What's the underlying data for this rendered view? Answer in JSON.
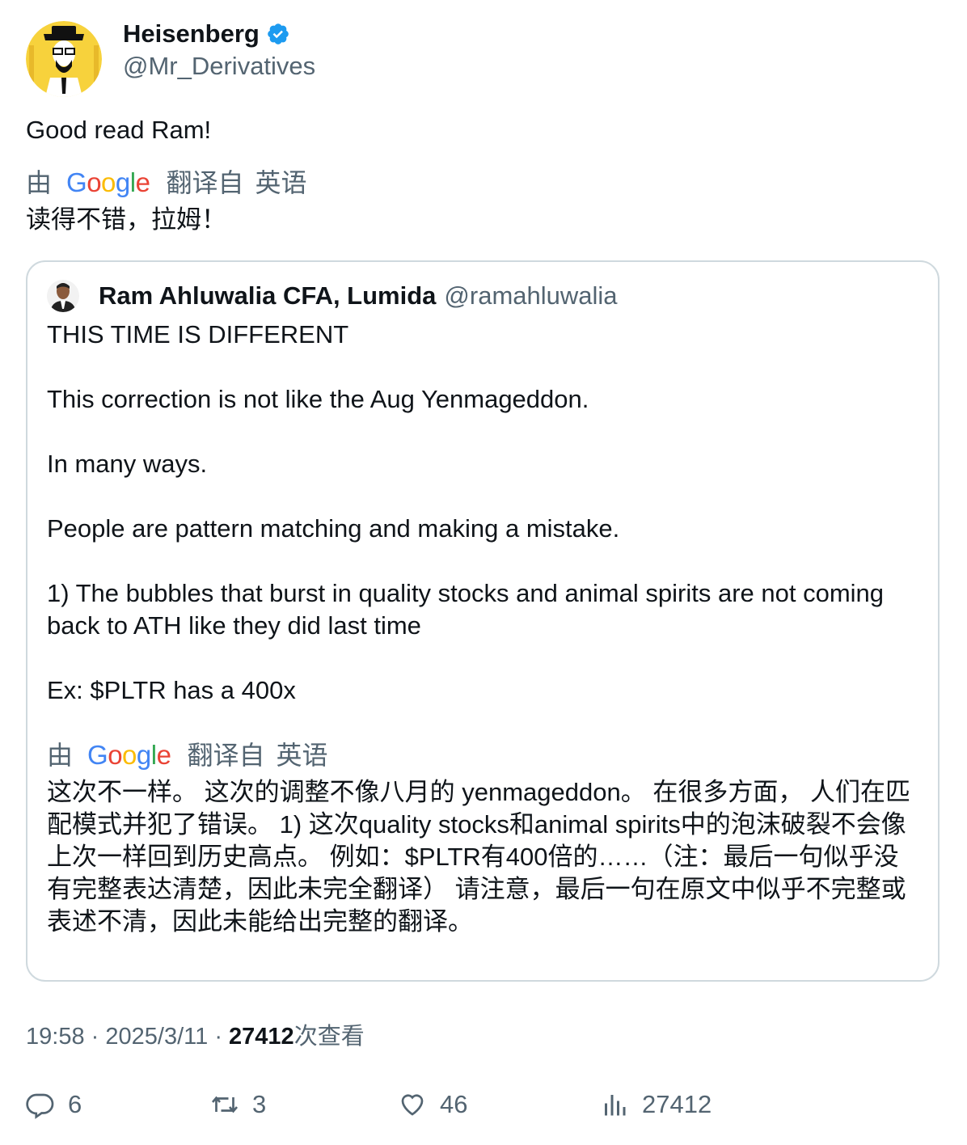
{
  "author": {
    "display_name": "Heisenberg",
    "handle": "@Mr_Derivatives",
    "verified": true
  },
  "tweet": {
    "text": "Good read Ram!",
    "translation_label": {
      "by": "由",
      "provider": "Google",
      "translated_from": "翻译自",
      "language": "英语"
    },
    "translation": "读得不错，拉姆！"
  },
  "quoted_tweet": {
    "display_name": "Ram Ahluwalia CFA, Lumida",
    "handle": "@ramahluwalia",
    "paragraphs": [
      "THIS TIME IS DIFFERENT",
      "This correction is not like the Aug Yenmageddon.",
      "In many ways.",
      "People are pattern matching and making a mistake.",
      "1) The bubbles that burst in quality stocks and animal spirits are not coming back to ATH like they did last time",
      "Ex: $PLTR has a 400x"
    ],
    "translation_label": {
      "by": "由",
      "provider": "Google",
      "translated_from": "翻译自",
      "language": "英语"
    },
    "translation": "这次不一样。 这次的调整不像八月的 yenmageddon。 在很多方面， 人们在匹配模式并犯了错误。 1) 这次quality stocks和animal spirits中的泡沫破裂不会像上次一样回到历史高点。 例如：$PLTR有400倍的……（注：最后一句似乎没有完整表达清楚，因此未完全翻译） 请注意，最后一句在原文中似乎不完整或表述不清，因此未能给出完整的翻译。"
  },
  "meta": {
    "time": "19:58",
    "separator": "·",
    "date": "2025/3/11",
    "views_count": "27412",
    "views_label": "次查看"
  },
  "actions": {
    "replies": "6",
    "retweets": "3",
    "likes": "46",
    "views": "27412"
  },
  "colors": {
    "text": "#0f1419",
    "secondary": "#536471",
    "verified": "#1d9bf0",
    "border": "#cfd9de"
  }
}
